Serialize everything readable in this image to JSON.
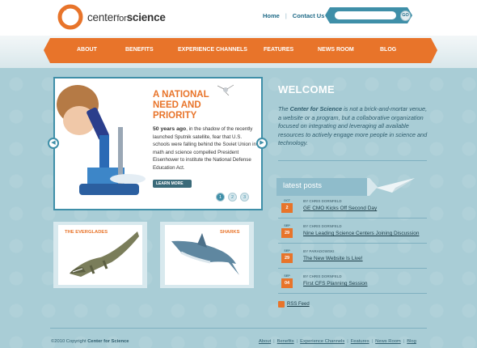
{
  "brand": {
    "logo_text_light": "center",
    "logo_text_mid": "for",
    "logo_text_bold": "science",
    "accent": "#e8742a",
    "primary": "#3f8fa8"
  },
  "top_links": [
    "Home",
    "Contact Us"
  ],
  "search": {
    "placeholder": "",
    "go_label": "GO"
  },
  "nav": [
    "ABOUT",
    "BENEFITS",
    "EXPERIENCE CHANNELS",
    "FEATURES",
    "NEWS ROOM",
    "BLOG"
  ],
  "hero": {
    "title": "A NATIONAL NEED AND PRIORITY",
    "text_lead": "50 years ago",
    "text_body": ", in the shadow of the recently launched Sputnik satellite, fear that U.S. schools were falling behind the Soviet Union in math and science compelled President Eisenhower to institute the National Defense Education Act.",
    "learn_more": "LEARN MORE",
    "pages": [
      "1",
      "2",
      "3"
    ],
    "active_page": 0
  },
  "welcome": {
    "title": "WELCOME",
    "lead": "The ",
    "brand": "Center for Science",
    "text": " is not a brick-and-mortar venue, a website or a program, but a collaborative organization focused on integrating and leveraging all available resources to actively engage more people in science and technology."
  },
  "posts": {
    "title": "latest posts",
    "items": [
      {
        "month": "OCT",
        "day": "2",
        "by": "By CHRIS DORNFELD",
        "title": "GE CMO Kicks Off Second Day"
      },
      {
        "month": "SEP",
        "day": "29",
        "by": "By CHRIS DORNFELD",
        "title": "Nine Leading Science Centers Joining Discussion"
      },
      {
        "month": "SEP",
        "day": "29",
        "by": "By PARADOWSKI",
        "title": "The New Website Is Live!"
      },
      {
        "month": "SEP",
        "day": "04",
        "by": "By CHRIS DORNFELD",
        "title": "First CFS Planning Session"
      }
    ],
    "rss": "RSS Feed"
  },
  "cards": [
    {
      "title": "THE EVERGLADES",
      "icon": "alligator-icon"
    },
    {
      "title": "SHARKS",
      "icon": "shark-icon"
    }
  ],
  "footer": {
    "copyright_prefix": "©2010 Copyright ",
    "copyright_brand": "Center for Science",
    "links": [
      "About",
      "Benefits",
      "Experience Channels",
      "Features",
      "News Room",
      "Blog"
    ]
  }
}
